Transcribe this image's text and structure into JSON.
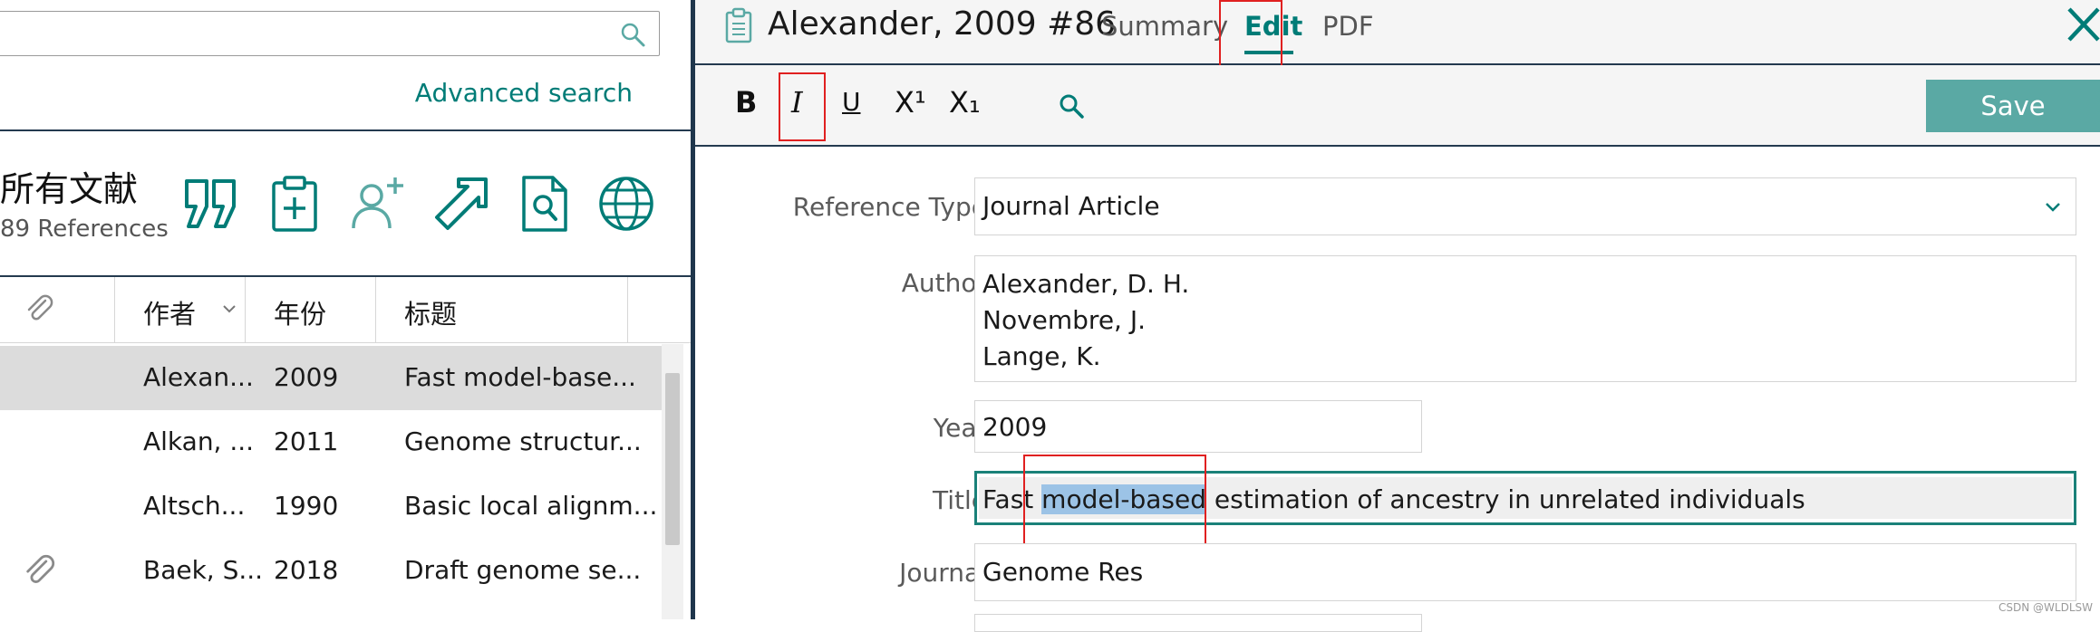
{
  "left": {
    "search": {
      "value": "",
      "placeholder": ""
    },
    "advanced_search": "Advanced search",
    "library": {
      "title": "所有文献",
      "count": "89 References"
    },
    "toolbar_icons": [
      "quote-icon",
      "add-to-group-icon",
      "share-user-icon",
      "export-icon",
      "find-fulltext-icon",
      "online-search-icon"
    ],
    "columns": [
      "作者",
      "年份",
      "标题"
    ],
    "rows": [
      {
        "author": "Alexan...",
        "year": "2009",
        "title": "Fast model-base...",
        "attachment": false,
        "selected": true
      },
      {
        "author": "Alkan, ...",
        "year": "2011",
        "title": "Genome structur...",
        "attachment": false,
        "selected": false
      },
      {
        "author": "Altsch...",
        "year": "1990",
        "title": "Basic local alignm...",
        "attachment": false,
        "selected": false
      },
      {
        "author": "Baek, S...",
        "year": "2018",
        "title": "Draft genome se...",
        "attachment": true,
        "selected": false
      }
    ]
  },
  "right": {
    "ref_title": "Alexander, 2009 #86",
    "tabs": {
      "summary": "Summary",
      "edit": "Edit",
      "pdf": "PDF"
    },
    "format": {
      "bold": "B",
      "italic": "I",
      "underline": "U",
      "superscript": "X¹",
      "subscript": "X₁"
    },
    "save_label": "Save",
    "fields": {
      "reference_type": {
        "label": "Reference Type",
        "value": "Journal Article"
      },
      "author": {
        "label": "Author",
        "values": [
          "Alexander, D. H.",
          "Novembre, J.",
          "Lange, K."
        ]
      },
      "year": {
        "label": "Year",
        "value": "2009"
      },
      "title": {
        "label": "Title",
        "before": "Fast ",
        "highlight": "model-based",
        "after": " estimation of ancestry in unrelated individuals"
      },
      "journal": {
        "label": "Journal",
        "value": "Genome Res"
      }
    }
  },
  "watermark": "CSDN @WLDLSW",
  "colors": {
    "accent": "#007c77",
    "divider": "#243a4f",
    "annotation": "#e02020",
    "selection": "#9cc3e6"
  }
}
